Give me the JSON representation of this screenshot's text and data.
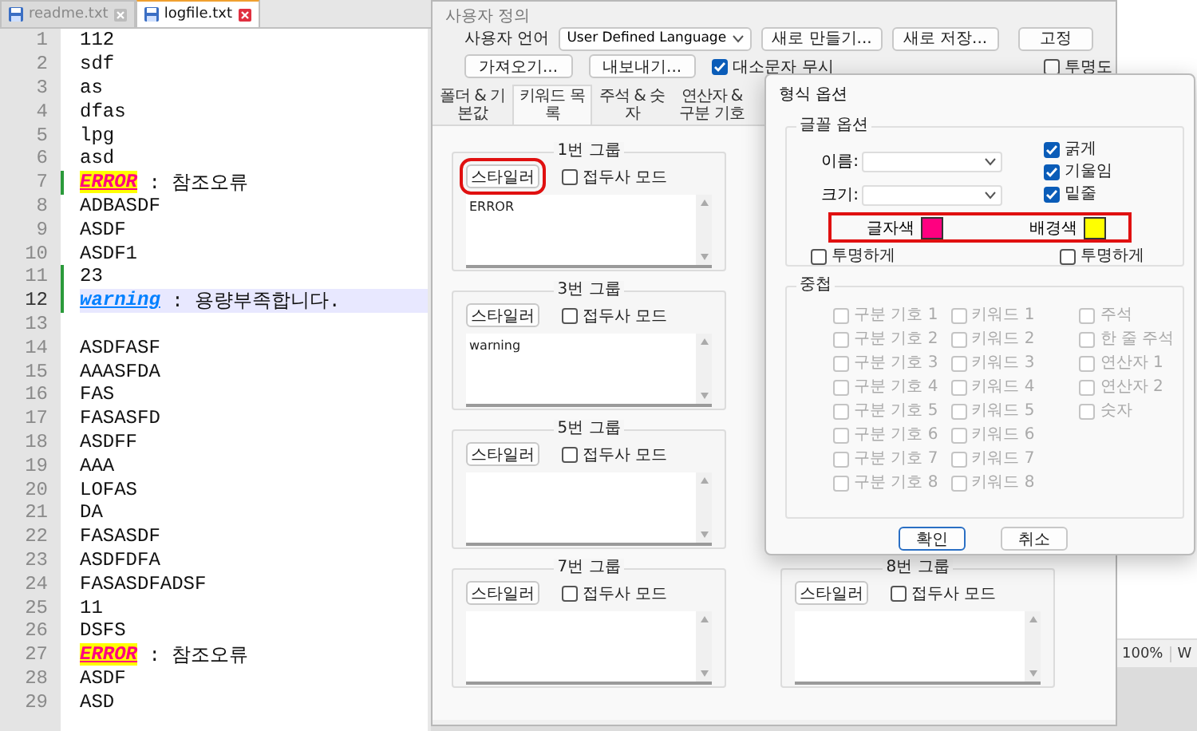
{
  "editor": {
    "tabs": [
      {
        "label": "readme.txt",
        "selected": false
      },
      {
        "label": "logfile.txt",
        "selected": true
      }
    ],
    "lines": [
      {
        "number": "1",
        "kind": "plain",
        "text": "112",
        "changed": false,
        "current": false
      },
      {
        "number": "2",
        "kind": "plain",
        "text": "sdf",
        "changed": false,
        "current": false
      },
      {
        "number": "3",
        "kind": "plain",
        "text": "as",
        "changed": false,
        "current": false
      },
      {
        "number": "4",
        "kind": "plain",
        "text": "dfas",
        "changed": false,
        "current": false
      },
      {
        "number": "5",
        "kind": "plain",
        "text": "lpg",
        "changed": false,
        "current": false
      },
      {
        "number": "6",
        "kind": "plain",
        "text": "asd",
        "changed": false,
        "current": false
      },
      {
        "number": "7",
        "kind": "error",
        "keyword": "ERROR",
        "text": " : 참조오류",
        "changed": true,
        "current": false
      },
      {
        "number": "8",
        "kind": "plain",
        "text": "ADBASDF",
        "changed": false,
        "current": false
      },
      {
        "number": "9",
        "kind": "plain",
        "text": "ASDF",
        "changed": false,
        "current": false
      },
      {
        "number": "10",
        "kind": "plain",
        "text": "ASDF1",
        "changed": false,
        "current": false
      },
      {
        "number": "11",
        "kind": "plain",
        "text": "23",
        "changed": true,
        "current": false
      },
      {
        "number": "12",
        "kind": "warning",
        "keyword": "warning",
        "text": " : 용량부족합니다.",
        "changed": true,
        "current": true
      },
      {
        "number": "13",
        "kind": "plain",
        "changed": false,
        "current": false
      },
      {
        "number": "14",
        "kind": "plain",
        "text": "ASDFASF",
        "changed": false,
        "current": false
      },
      {
        "number": "15",
        "kind": "plain",
        "text": "AAASFDA",
        "changed": false,
        "current": false
      },
      {
        "number": "16",
        "kind": "plain",
        "text": "FAS",
        "changed": false,
        "current": false
      },
      {
        "number": "17",
        "kind": "plain",
        "text": "FASASFD",
        "changed": false,
        "current": false
      },
      {
        "number": "18",
        "kind": "plain",
        "text": "ASDFF",
        "changed": false,
        "current": false
      },
      {
        "number": "19",
        "kind": "plain",
        "text": "AAA",
        "changed": false,
        "current": false
      },
      {
        "number": "20",
        "kind": "plain",
        "text": "LOFAS",
        "changed": false,
        "current": false
      },
      {
        "number": "21",
        "kind": "plain",
        "text": "DA",
        "changed": false,
        "current": false
      },
      {
        "number": "22",
        "kind": "plain",
        "text": "FASASDF",
        "changed": false,
        "current": false
      },
      {
        "number": "23",
        "kind": "plain",
        "text": "ASDFDFA",
        "changed": false,
        "current": false
      },
      {
        "number": "24",
        "kind": "plain",
        "text": "FASASDFADSF",
        "changed": false,
        "current": false
      },
      {
        "number": "25",
        "kind": "plain",
        "text": "11",
        "changed": false,
        "current": false
      },
      {
        "number": "26",
        "kind": "plain",
        "text": "DSFS",
        "changed": false,
        "current": false
      },
      {
        "number": "27",
        "kind": "error",
        "keyword": "ERROR",
        "text": " : 참조오류",
        "changed": false,
        "current": false
      },
      {
        "number": "28",
        "kind": "plain",
        "text": "ASDF",
        "changed": false,
        "current": false
      },
      {
        "number": "29",
        "kind": "plain",
        "text": "ASD",
        "changed": false,
        "current": false
      }
    ]
  },
  "back_window": {
    "status_bar": [
      "100%",
      "W"
    ]
  },
  "user_defined_dialog": {
    "title": "사용자 정의",
    "language_label": "사용자 언어",
    "language": "User Defined Language",
    "new_buttons": [
      "새로 만들기...",
      "새로 저장..."
    ],
    "dock_button": "고정",
    "file_buttons": [
      "가져오기...",
      "내보내기..."
    ],
    "ignore_case": {
      "label": "대소문자 무시",
      "checked": true
    },
    "transparency": {
      "label": "투명도",
      "checked": false
    },
    "tabs": [
      {
        "label": "폴더 & 기본값",
        "selected": false
      },
      {
        "label": "키워드 목록",
        "selected": true
      },
      {
        "label": "주석 & 숫자",
        "selected": false
      },
      {
        "label": "연산자 & 구분 기호",
        "selected": false
      }
    ],
    "left_groups": [
      {
        "title": "1번 그룹",
        "styler": "스타일러",
        "highlighted": true,
        "prefix": {
          "label": "접두사 모드",
          "checked": false
        },
        "keywords": "ERROR"
      },
      {
        "title": "3번 그룹",
        "styler": "스타일러",
        "highlighted": false,
        "prefix": {
          "label": "접두사 모드",
          "checked": false
        },
        "keywords": "warning"
      },
      {
        "title": "5번 그룹",
        "styler": "스타일러",
        "highlighted": false,
        "prefix": {
          "label": "접두사 모드",
          "checked": false
        }
      },
      {
        "title": "7번 그룹",
        "styler": "스타일러",
        "highlighted": false,
        "prefix": {
          "label": "접두사 모드",
          "checked": false
        }
      }
    ],
    "right_groups": [
      {
        "title": "8번 그룹",
        "styler": "스타일러",
        "highlighted": false,
        "prefix": {
          "label": "접두사 모드",
          "checked": false
        }
      }
    ]
  },
  "format_dialog": {
    "title": "형식 옵션",
    "font_group": "글꼴 옵션",
    "name_label": "이름:",
    "size_label": "크기:",
    "styles": [
      {
        "label": "굵게",
        "checked": true
      },
      {
        "label": "기울임",
        "checked": true
      },
      {
        "label": "밑줄",
        "checked": true
      }
    ],
    "colors_highlighted": true,
    "colors": [
      {
        "label": "글자색",
        "color": "#ff0080"
      },
      {
        "label": "배경색",
        "color": "#ffff00"
      }
    ],
    "transparent": [
      {
        "label": "투명하게",
        "checked": false
      },
      {
        "label": "투명하게",
        "checked": false
      }
    ],
    "nesting_group": "중첩",
    "nesting": [
      [
        {
          "label": "구분 기호 1",
          "checked": false,
          "disabled": true
        },
        {
          "label": "구분 기호 2",
          "checked": false,
          "disabled": true
        },
        {
          "label": "구분 기호 3",
          "checked": false,
          "disabled": true
        },
        {
          "label": "구분 기호 4",
          "checked": false,
          "disabled": true
        },
        {
          "label": "구분 기호 5",
          "checked": false,
          "disabled": true
        },
        {
          "label": "구분 기호 6",
          "checked": false,
          "disabled": true
        },
        {
          "label": "구분 기호 7",
          "checked": false,
          "disabled": true
        },
        {
          "label": "구분 기호 8",
          "checked": false,
          "disabled": true
        }
      ],
      [
        {
          "label": "키워드 1",
          "checked": false,
          "disabled": true
        },
        {
          "label": "키워드 2",
          "checked": false,
          "disabled": true
        },
        {
          "label": "키워드 3",
          "checked": false,
          "disabled": true
        },
        {
          "label": "키워드 4",
          "checked": false,
          "disabled": true
        },
        {
          "label": "키워드 5",
          "checked": false,
          "disabled": true
        },
        {
          "label": "키워드 6",
          "checked": false,
          "disabled": true
        },
        {
          "label": "키워드 7",
          "checked": false,
          "disabled": true
        },
        {
          "label": "키워드 8",
          "checked": false,
          "disabled": true
        }
      ],
      [
        {
          "label": "주석",
          "checked": false,
          "disabled": true
        },
        {
          "label": "한 줄 주석",
          "checked": false,
          "disabled": true
        },
        {
          "label": "연산자 1",
          "checked": false,
          "disabled": true
        },
        {
          "label": "연산자 2",
          "checked": false,
          "disabled": true
        },
        {
          "label": "숫자",
          "checked": false,
          "disabled": true
        }
      ]
    ],
    "buttons": [
      {
        "label": "확인",
        "default": true
      },
      {
        "label": "취소",
        "default": false
      }
    ]
  }
}
